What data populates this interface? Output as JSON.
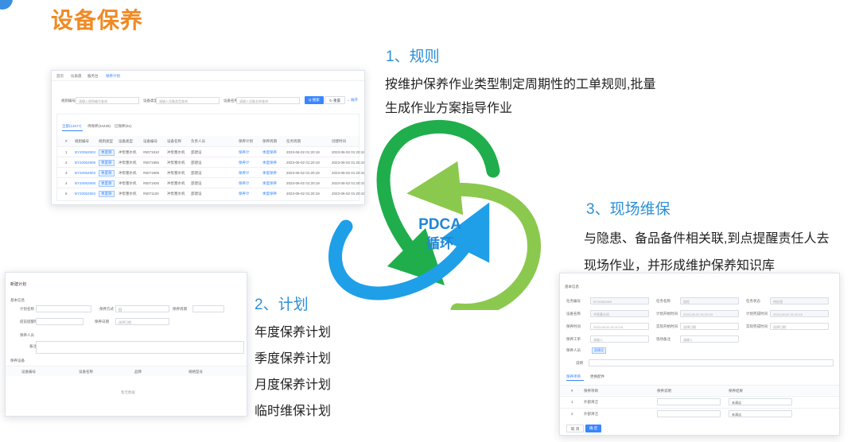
{
  "page": {
    "title": "设备保养"
  },
  "sections": {
    "rule": {
      "heading": "1、规则",
      "lines": [
        "按维护保养作业类型制定周期性的工单规则,批量",
        "生成作业方案指导作业"
      ]
    },
    "plan": {
      "heading": "2、计划",
      "lines": [
        "年度保养计划",
        "季度保养计划",
        "月度保养计划",
        "临时维保计划"
      ]
    },
    "onsite": {
      "heading": "3、现场维保",
      "lines": [
        "与隐患、备品备件相关联,到点提醒责任人去",
        "现场作业，并形成维护保养知识库"
      ]
    }
  },
  "cycle": {
    "line1": "PDCA",
    "line2": "循环",
    "colors": {
      "green": "#1fae4b",
      "lime": "#8bc94e",
      "blue": "#1f9fe8"
    }
  },
  "shot_rules": {
    "tabs": [
      "首页",
      "仪表盘",
      "服务台",
      "保养计划"
    ],
    "search": {
      "label1": "规则编号",
      "ph1": "请输入规则编号查询",
      "label2": "设备类型",
      "ph2": "请输入设备类型查询",
      "label3": "设备名称",
      "ph3": "请输入设备名称查询",
      "btn_search": "Q 搜索",
      "btn_reset": "↻ 重置",
      "btn_expand": "⌄ 展开"
    },
    "filter_tabs": [
      "全部(14677)",
      "待保养(34439)",
      "已保养(61)"
    ],
    "columns": [
      "#",
      "规则编号",
      "规则类型",
      "设备类型",
      "设备编号",
      "设备名称",
      "负责人员",
      "保养计划",
      "保养周期",
      "任务周期",
      "创建时间"
    ],
    "rows": [
      [
        "1",
        "BY20062903",
        "季度保",
        "冲泵塞水机",
        "#5071910",
        "冲泵塞水机",
        "邵建设",
        "保养计",
        "季度保养",
        "2023-06-02 01:20:19",
        "2023-06-02 01:20:19"
      ],
      [
        "2",
        "BY20062908",
        "季度保",
        "冲泵塞水机",
        "#5071955",
        "冲泵塞水机",
        "邵建设",
        "保养计",
        "季度保养",
        "2023-06-02 01:20:19",
        "2023-06-02 01:20:19"
      ],
      [
        "3",
        "BY20062903",
        "季度保",
        "冲泵塞水机",
        "#5071908",
        "冲泵塞水机",
        "邵建设",
        "保养计",
        "季度保养",
        "2023-06-02 01:20:19",
        "2023-06-02 01:20:19"
      ],
      [
        "4",
        "BY20062908",
        "季度保",
        "冲泵塞水机",
        "#5071925",
        "冲泵塞水机",
        "邵建设",
        "保养计",
        "季度保养",
        "2023-06-02 01:20:19",
        "2023-06-02 01:20:19"
      ],
      [
        "5",
        "BY20062903",
        "季度保",
        "冲泵塞水机",
        "#5071120",
        "冲泵塞水机",
        "邵建设",
        "保养计",
        "季度保养",
        "2023-06-02 01:20:19",
        "2023-06-02 01:20:19"
      ]
    ]
  },
  "shot_plan": {
    "title": "新建计划",
    "section1": "基本信息",
    "fields": [
      "计划名称",
      "保养方式",
      "保养周期",
      "提前提醒时间",
      "保养人员",
      "备注",
      "保养日期"
    ],
    "select1": "日",
    "date_ph": "选择日期",
    "section2": "保养设备",
    "columns": [
      "设备编号",
      "设备名称",
      "品牌",
      "规格型号"
    ],
    "empty": "暂无数据"
  },
  "shot_work": {
    "section1": "基本信息",
    "fields": [
      "任务编号",
      "任务名称",
      "任务状态",
      "设备名称",
      "计划开始时间",
      "计划完成时间",
      "保养时间",
      "实际开始时间",
      "实际完成时间",
      "保养工单",
      "现场备注"
    ],
    "values": [
      "BY20062909",
      "巡检",
      "待处理",
      "冲泵塞水机",
      "2023-06-02 01:20:19",
      "2023-06-02 01:20:19",
      "2023-06-02 01:20:19",
      "选择日期",
      "选择日期",
      "请输入",
      "请输入"
    ],
    "person_label": "保养人员",
    "person_tag": "邵建设",
    "note_label": "说明",
    "tabs": [
      "保养项目",
      "更换配件"
    ],
    "columns": [
      "#",
      "保养项目",
      "保养说明",
      "保养结果"
    ],
    "rows": [
      [
        "1",
        "外部清洁",
        "未清洁"
      ],
      [
        "2",
        "外部清洁",
        "未清洁"
      ]
    ],
    "btn_cancel": "取 消",
    "btn_ok": "确 定"
  }
}
